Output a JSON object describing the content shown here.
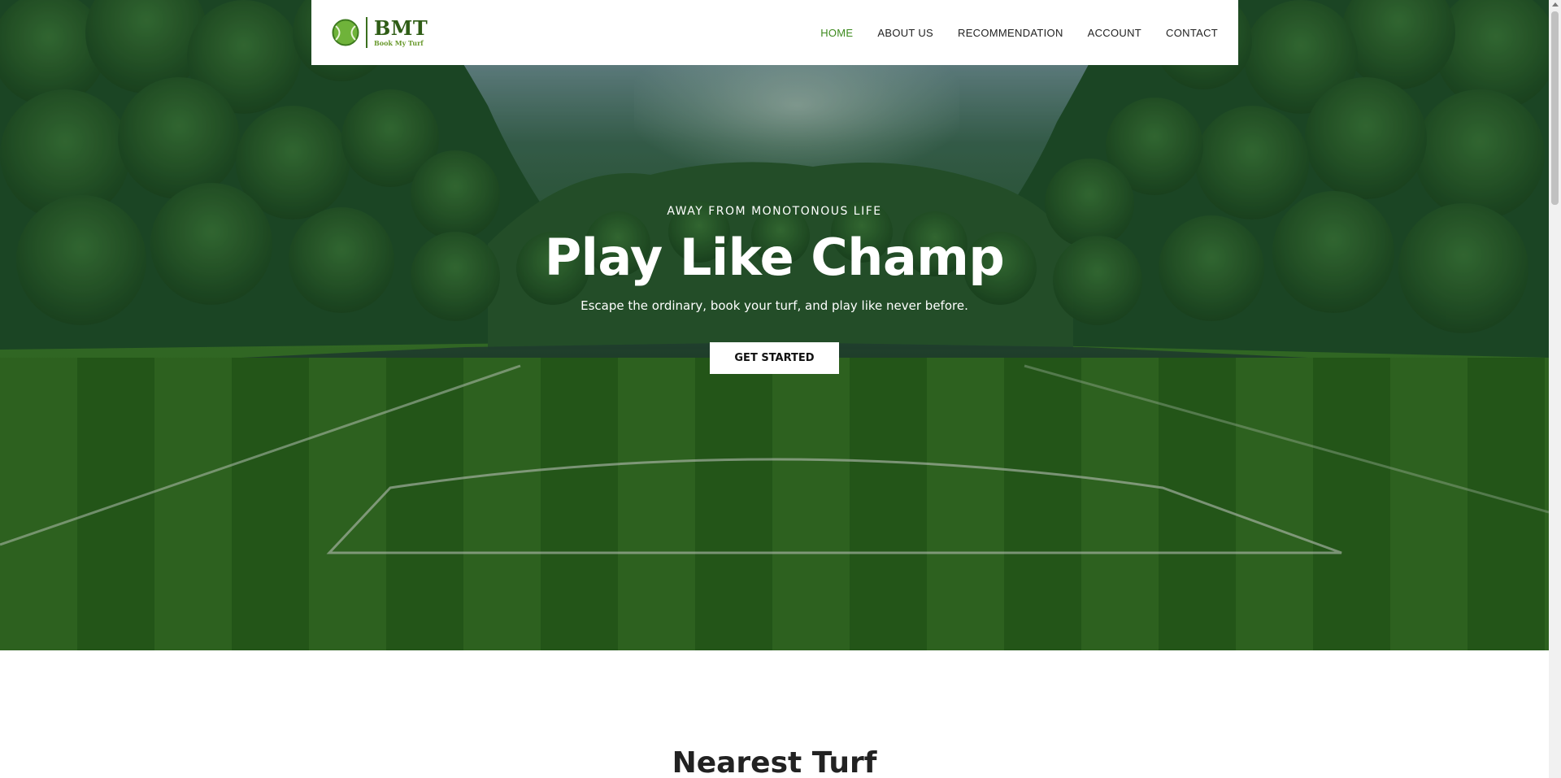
{
  "brand": {
    "title": "BMT",
    "subtitle": "Book My Turf",
    "color": "#2f5d16"
  },
  "nav": {
    "items": [
      {
        "label": "HOME",
        "active": true
      },
      {
        "label": "ABOUT US",
        "active": false
      },
      {
        "label": "RECOMMENDATION",
        "active": false
      },
      {
        "label": "ACCOUNT",
        "active": false
      },
      {
        "label": "CONTACT",
        "active": false
      }
    ],
    "active_color": "#3d8a1e"
  },
  "hero": {
    "eyebrow": "AWAY FROM MONOTONOUS LIFE",
    "headline": "Play Like Champ",
    "subline": "Escape the ordinary, book your turf, and play like never before.",
    "cta_label": "GET STARTED"
  },
  "sections": {
    "nearest_turf_title": "Nearest Turf"
  }
}
